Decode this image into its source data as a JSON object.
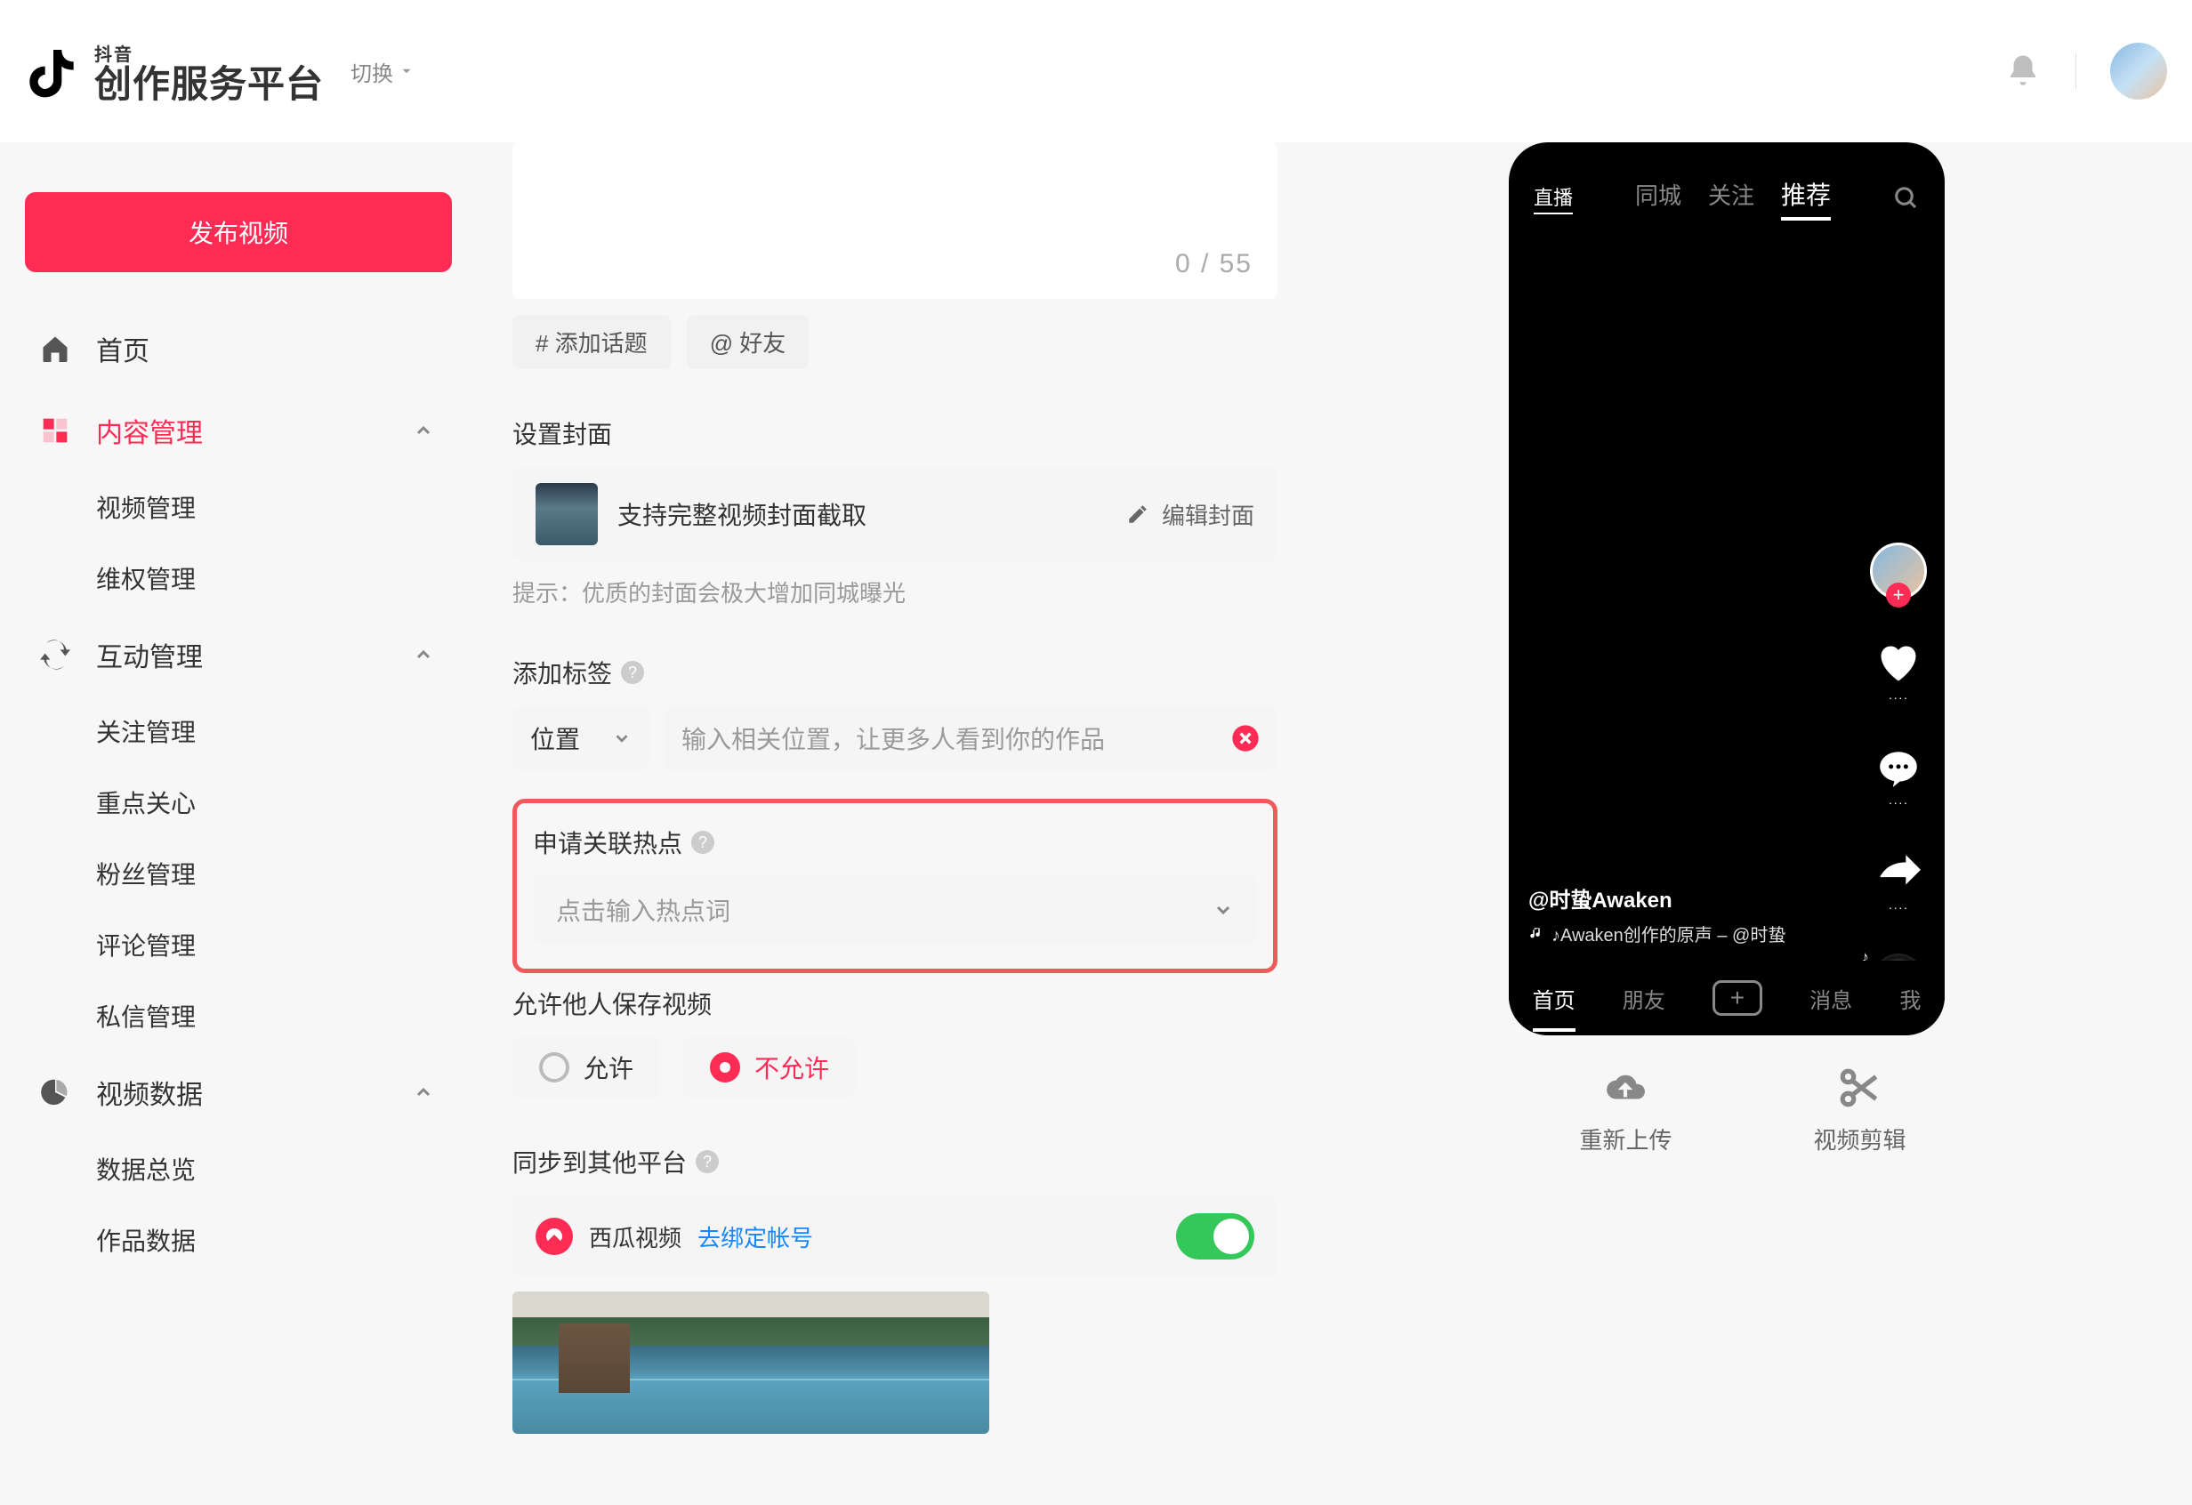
{
  "header": {
    "brand_small": "抖音",
    "brand_large": "创作服务平台",
    "switch_label": "切换"
  },
  "sidebar": {
    "publish_label": "发布视频",
    "home_label": "首页",
    "content_mgmt": {
      "label": "内容管理",
      "video_mgmt": "视频管理",
      "rights_mgmt": "维权管理"
    },
    "interaction_mgmt": {
      "label": "互动管理",
      "follow_mgmt": "关注管理",
      "key_focus": "重点关心",
      "fans_mgmt": "粉丝管理",
      "comment_mgmt": "评论管理",
      "dm_mgmt": "私信管理"
    },
    "video_data": {
      "label": "视频数据",
      "overview": "数据总览",
      "works": "作品数据"
    }
  },
  "form": {
    "counter": "0  /  55",
    "topic_chip": "# 添加话题",
    "friend_chip": "@ 好友",
    "cover_heading": "设置封面",
    "cover_support": "支持完整视频封面截取",
    "cover_edit": "编辑封面",
    "cover_hint": "提示：优质的封面会极大增加同城曝光",
    "tag_heading": "添加标签",
    "tag_select": "位置",
    "tag_placeholder": "输入相关位置，让更多人看到你的作品",
    "hot_heading": "申请关联热点",
    "hot_placeholder": "点击输入热点词",
    "save_heading": "允许他人保存视频",
    "save_allow": "允许",
    "save_deny": "不允许",
    "sync_heading": "同步到其他平台",
    "xigua_label": "西瓜视频",
    "bind_link": "去绑定帐号"
  },
  "preview": {
    "live": "直播",
    "nav_local": "同城",
    "nav_follow": "关注",
    "nav_recommend": "推荐",
    "username": "@时蛰Awaken",
    "sound": "♪Awaken创作的原声 – @时蛰",
    "action_like": "····",
    "action_comment": "····",
    "action_share": "····",
    "tab_home": "首页",
    "tab_friends": "朋友",
    "tab_msg": "消息",
    "tab_me": "我",
    "reupload": "重新上传",
    "clip": "视频剪辑"
  }
}
